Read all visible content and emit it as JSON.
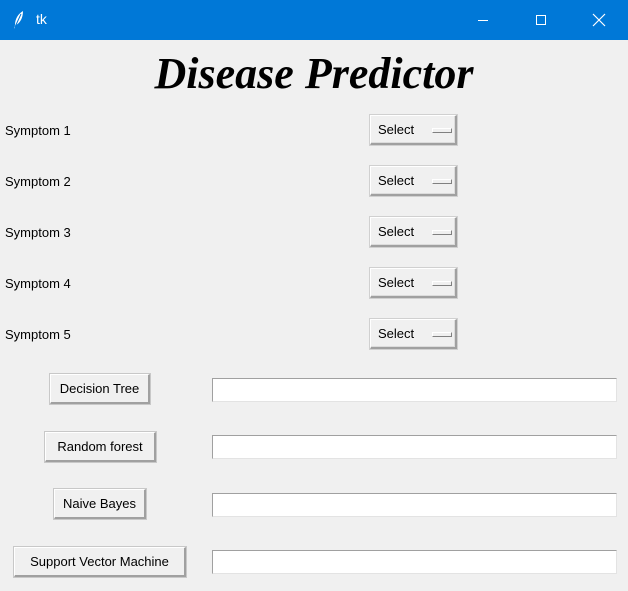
{
  "window": {
    "title": "tk"
  },
  "app": {
    "heading": "Disease Predictor"
  },
  "symptoms": [
    {
      "label": "Symptom 1",
      "value": "Select"
    },
    {
      "label": "Symptom 2",
      "value": "Select"
    },
    {
      "label": "Symptom 3",
      "value": "Select"
    },
    {
      "label": "Symptom 4",
      "value": "Select"
    },
    {
      "label": "Symptom 5",
      "value": "Select"
    }
  ],
  "algorithms": [
    {
      "label": "Decision Tree",
      "result": ""
    },
    {
      "label": "Random forest",
      "result": ""
    },
    {
      "label": "Naive Bayes",
      "result": ""
    },
    {
      "label": "Support Vector Machine",
      "result": ""
    }
  ],
  "icons": {
    "app": "feather-icon",
    "minimize": "minimize-icon",
    "maximize": "maximize-icon",
    "close": "close-icon"
  },
  "colors": {
    "titlebar": "#0078d7",
    "background": "#f0f0f0"
  }
}
